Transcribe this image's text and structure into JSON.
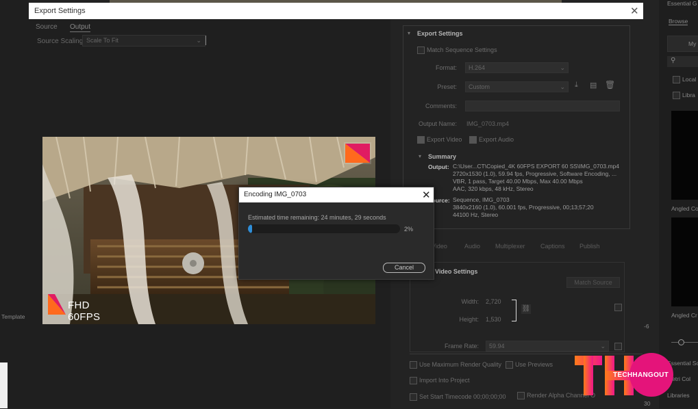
{
  "dialog": {
    "title": "Export Settings",
    "close": "✕"
  },
  "left": {
    "tabs": [
      "Source",
      "Output"
    ],
    "source_scaling_label": "Source Scaling:",
    "source_scaling_value": "Scale To Fit",
    "overlay_badge": "FHD 60FPS"
  },
  "export": {
    "header": "Export Settings",
    "match_sequence": "Match Sequence Settings",
    "format_label": "Format:",
    "format_value": "H.264",
    "preset_label": "Preset:",
    "preset_value": "Custom",
    "comments_label": "Comments:",
    "output_name_label": "Output Name:",
    "output_name_value": "IMG_0703.mp4",
    "export_video": "Export Video",
    "export_audio": "Export Audio",
    "summary_header": "Summary",
    "output_label": "Output:",
    "output_lines": [
      "C:\\User...CT\\Copied_4K 60FPS EXPORT 60 SS\\IMG_0703.mp4",
      "2720x1530 (1.0), 59.94 fps, Progressive, Software Encoding, ...",
      "VBR, 1 pass, Target 40.00 Mbps, Max 40.00 Mbps",
      "AAC, 320 kbps, 48 kHz, Stereo"
    ],
    "source_label": "Source:",
    "source_lines": [
      "Sequence, IMG_0703",
      "3840x2160 (1.0), 60.001 fps, Progressive, 00;13;57;20",
      "44100 Hz, Stereo"
    ]
  },
  "subtabs": [
    "Video",
    "Audio",
    "Multiplexer",
    "Captions",
    "Publish"
  ],
  "video_settings": {
    "header": "Video Settings",
    "match_source": "Match Source",
    "width_label": "Width:",
    "width_value": "2,720",
    "height_label": "Height:",
    "height_value": "1,530",
    "framerate_label": "Frame Rate:",
    "framerate_value": "59.94"
  },
  "bottom": {
    "max_render": "Use Maximum Render Quality",
    "use_previews": "Use Previews",
    "import_project": "Import Into Project",
    "start_timecode": "Set Start Timecode",
    "timecode_value": "00;00;00;00",
    "render_alpha": "Render Alpha Channel O"
  },
  "modal": {
    "title": "Encoding IMG_0703",
    "close": "✕",
    "eta": "Estimated time remaining: 24 minutes, 29 seconds",
    "progress": 0.02,
    "percent": "2%",
    "cancel": "Cancel"
  },
  "bg_app": {
    "essential": "Essential G",
    "browse": "Browse",
    "my": "My",
    "local": "Local",
    "libra": "Libra",
    "angled1": "Angled Co",
    "angled2": "Angled Cr",
    "essential_sc": "Essential Sc",
    "metri": "Metri Col",
    "libraries": "Libraries",
    "template": "Template",
    "tick_30": "30",
    "tick_6": "-6"
  },
  "watermark": {
    "text": "TECHHANGOUT",
    "accent": "#e4147a",
    "gradient_start": "#ff7a1a",
    "gradient_end": "#f0168a"
  }
}
